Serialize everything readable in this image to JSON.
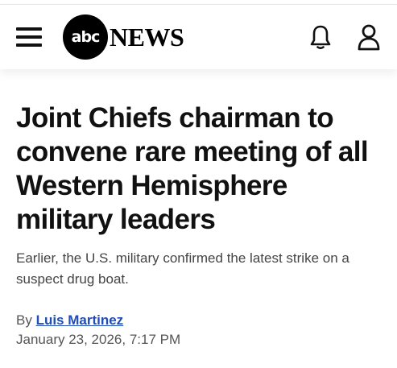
{
  "header": {
    "logo_circle_text": "abc",
    "logo_wordmark": "NEWS",
    "menu_icon": "hamburger-menu-icon",
    "notification_icon": "bell-icon",
    "account_icon": "user-icon"
  },
  "article": {
    "headline": "Joint Chiefs chairman to convene rare meeting of all Western Hemisphere military leaders",
    "dek": "Earlier, the U.S. military confirmed the latest strike on a suspect drug boat.",
    "byline_prefix": "By ",
    "author": "Luis Martinez",
    "date": "January 23, 2026, 7:17 PM"
  },
  "colors": {
    "author_link": "#1f4db5",
    "headline": "#111111"
  }
}
